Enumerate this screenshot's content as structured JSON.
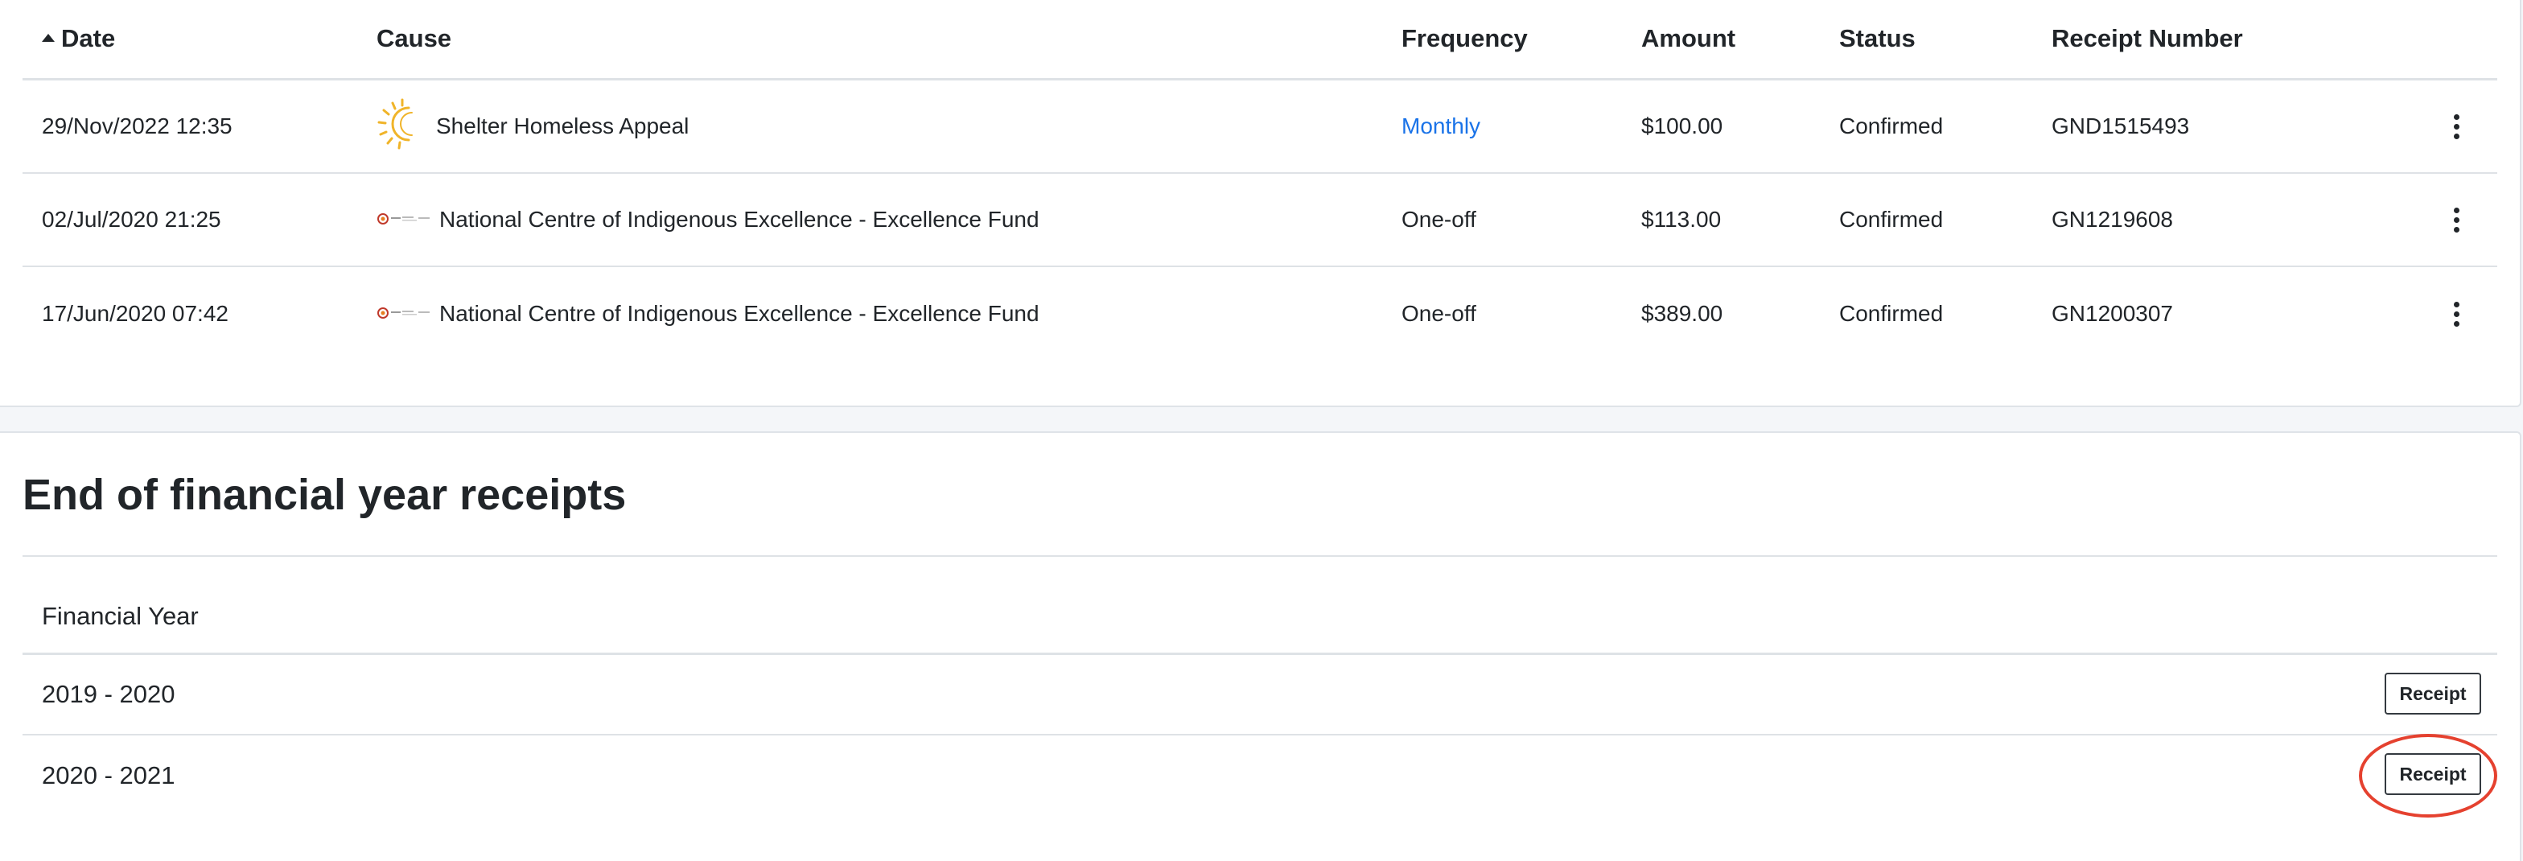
{
  "donations": {
    "columns": {
      "date": "Date",
      "cause": "Cause",
      "frequency": "Frequency",
      "amount": "Amount",
      "status": "Status",
      "receipt_number": "Receipt Number"
    },
    "sort_icon": "sort-ascending-icon",
    "rows": [
      {
        "date": "29/Nov/2022 12:35",
        "cause_logo": "sun-logo-icon",
        "cause": "Shelter Homeless Appeal",
        "frequency": "Monthly",
        "amount": "$100.00",
        "status": "Confirmed",
        "receipt_number": "GND1515493"
      },
      {
        "date": "02/Jul/2020 21:25",
        "cause_logo": "ncie-logo-icon",
        "cause": "National Centre of Indigenous Excellence - Excellence Fund",
        "frequency": "One-off",
        "amount": "$113.00",
        "status": "Confirmed",
        "receipt_number": "GN1219608"
      },
      {
        "date": "17/Jun/2020 07:42",
        "cause_logo": "ncie-logo-icon",
        "cause": "National Centre of Indigenous Excellence - Excellence Fund",
        "frequency": "One-off",
        "amount": "$389.00",
        "status": "Confirmed",
        "receipt_number": "GN1200307"
      }
    ],
    "row_menu_icon": "more-vertical-icon"
  },
  "eofy": {
    "title": "End of financial year receipts",
    "column": "Financial Year",
    "rows": [
      {
        "year": "2019 - 2020",
        "button": "Receipt"
      },
      {
        "year": "2020 - 2021",
        "button": "Receipt"
      }
    ]
  },
  "colors": {
    "link": "#1a73e8",
    "highlight": "#e5412f",
    "sun_logo": "#f0b429"
  }
}
